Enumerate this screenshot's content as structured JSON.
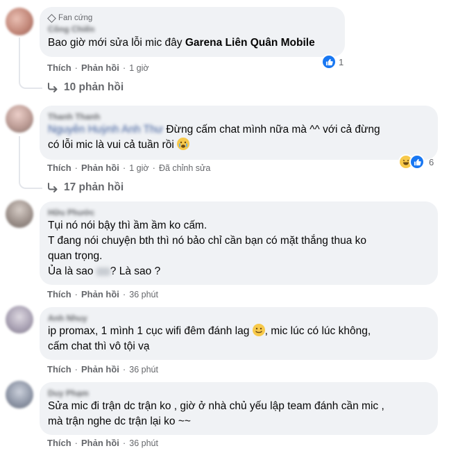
{
  "actions": {
    "like": "Thích",
    "reply": "Phản hồi",
    "edited": "Đã chỉnh sửa"
  },
  "comments": [
    {
      "author": "Công Chiến",
      "badge": "Fan cứng",
      "text_lines": [
        "Bao giờ mới sửa lỗi mic đây"
      ],
      "tag": "Garena Liên Quân Mobile",
      "time": "1 giờ",
      "reactions": {
        "count": "1",
        "icons": [
          "like-icon"
        ]
      },
      "replies": "10 phản hồi"
    },
    {
      "author": "Thanh Thanh",
      "mention": "Nguyễn Huỳnh Anh Thư",
      "text_line1": "Đừng cấm chat mình nữa mà ^^ với cả đừng",
      "text_line2": "có lỗi mic là vui cả tuần rồi",
      "time": "1 giờ",
      "edited": true,
      "reactions": {
        "count": "6",
        "icons": [
          "haha-icon",
          "like-icon"
        ]
      },
      "replies": "17 phản hồi"
    },
    {
      "author": "Hữu Phước",
      "text_lines": [
        "Tụi nó nói bậy thì ầm ầm ko cấm.",
        "T đang nói chuyện bth thì nó bảo chỉ cần bạn có mặt thắng thua ko",
        "quan trọng."
      ],
      "last_line_a": "Ủa là sao",
      "last_line_b": "? Là sao ?",
      "time": "36 phút"
    },
    {
      "author": "Anh Nhuy",
      "text_line1a": "ip promax, 1 mình 1 cục wifi đêm đánh lag",
      "text_line1b": ", mic lúc có lúc không,",
      "text_line2": "cấm chat thì vô tội vạ",
      "time": "36 phút"
    },
    {
      "author": "Duy Phạm",
      "text_lines": [
        "Sửa mic đi trận dc trận ko , giờ ở nhà chủ yếu lập team đánh cần mic ,",
        "mà trận nghe dc trận lại ko ~~"
      ],
      "time": "36 phút"
    }
  ],
  "colors": {
    "bubble": "#f0f2f5",
    "meta": "#65676b",
    "like": "#1877f2"
  }
}
